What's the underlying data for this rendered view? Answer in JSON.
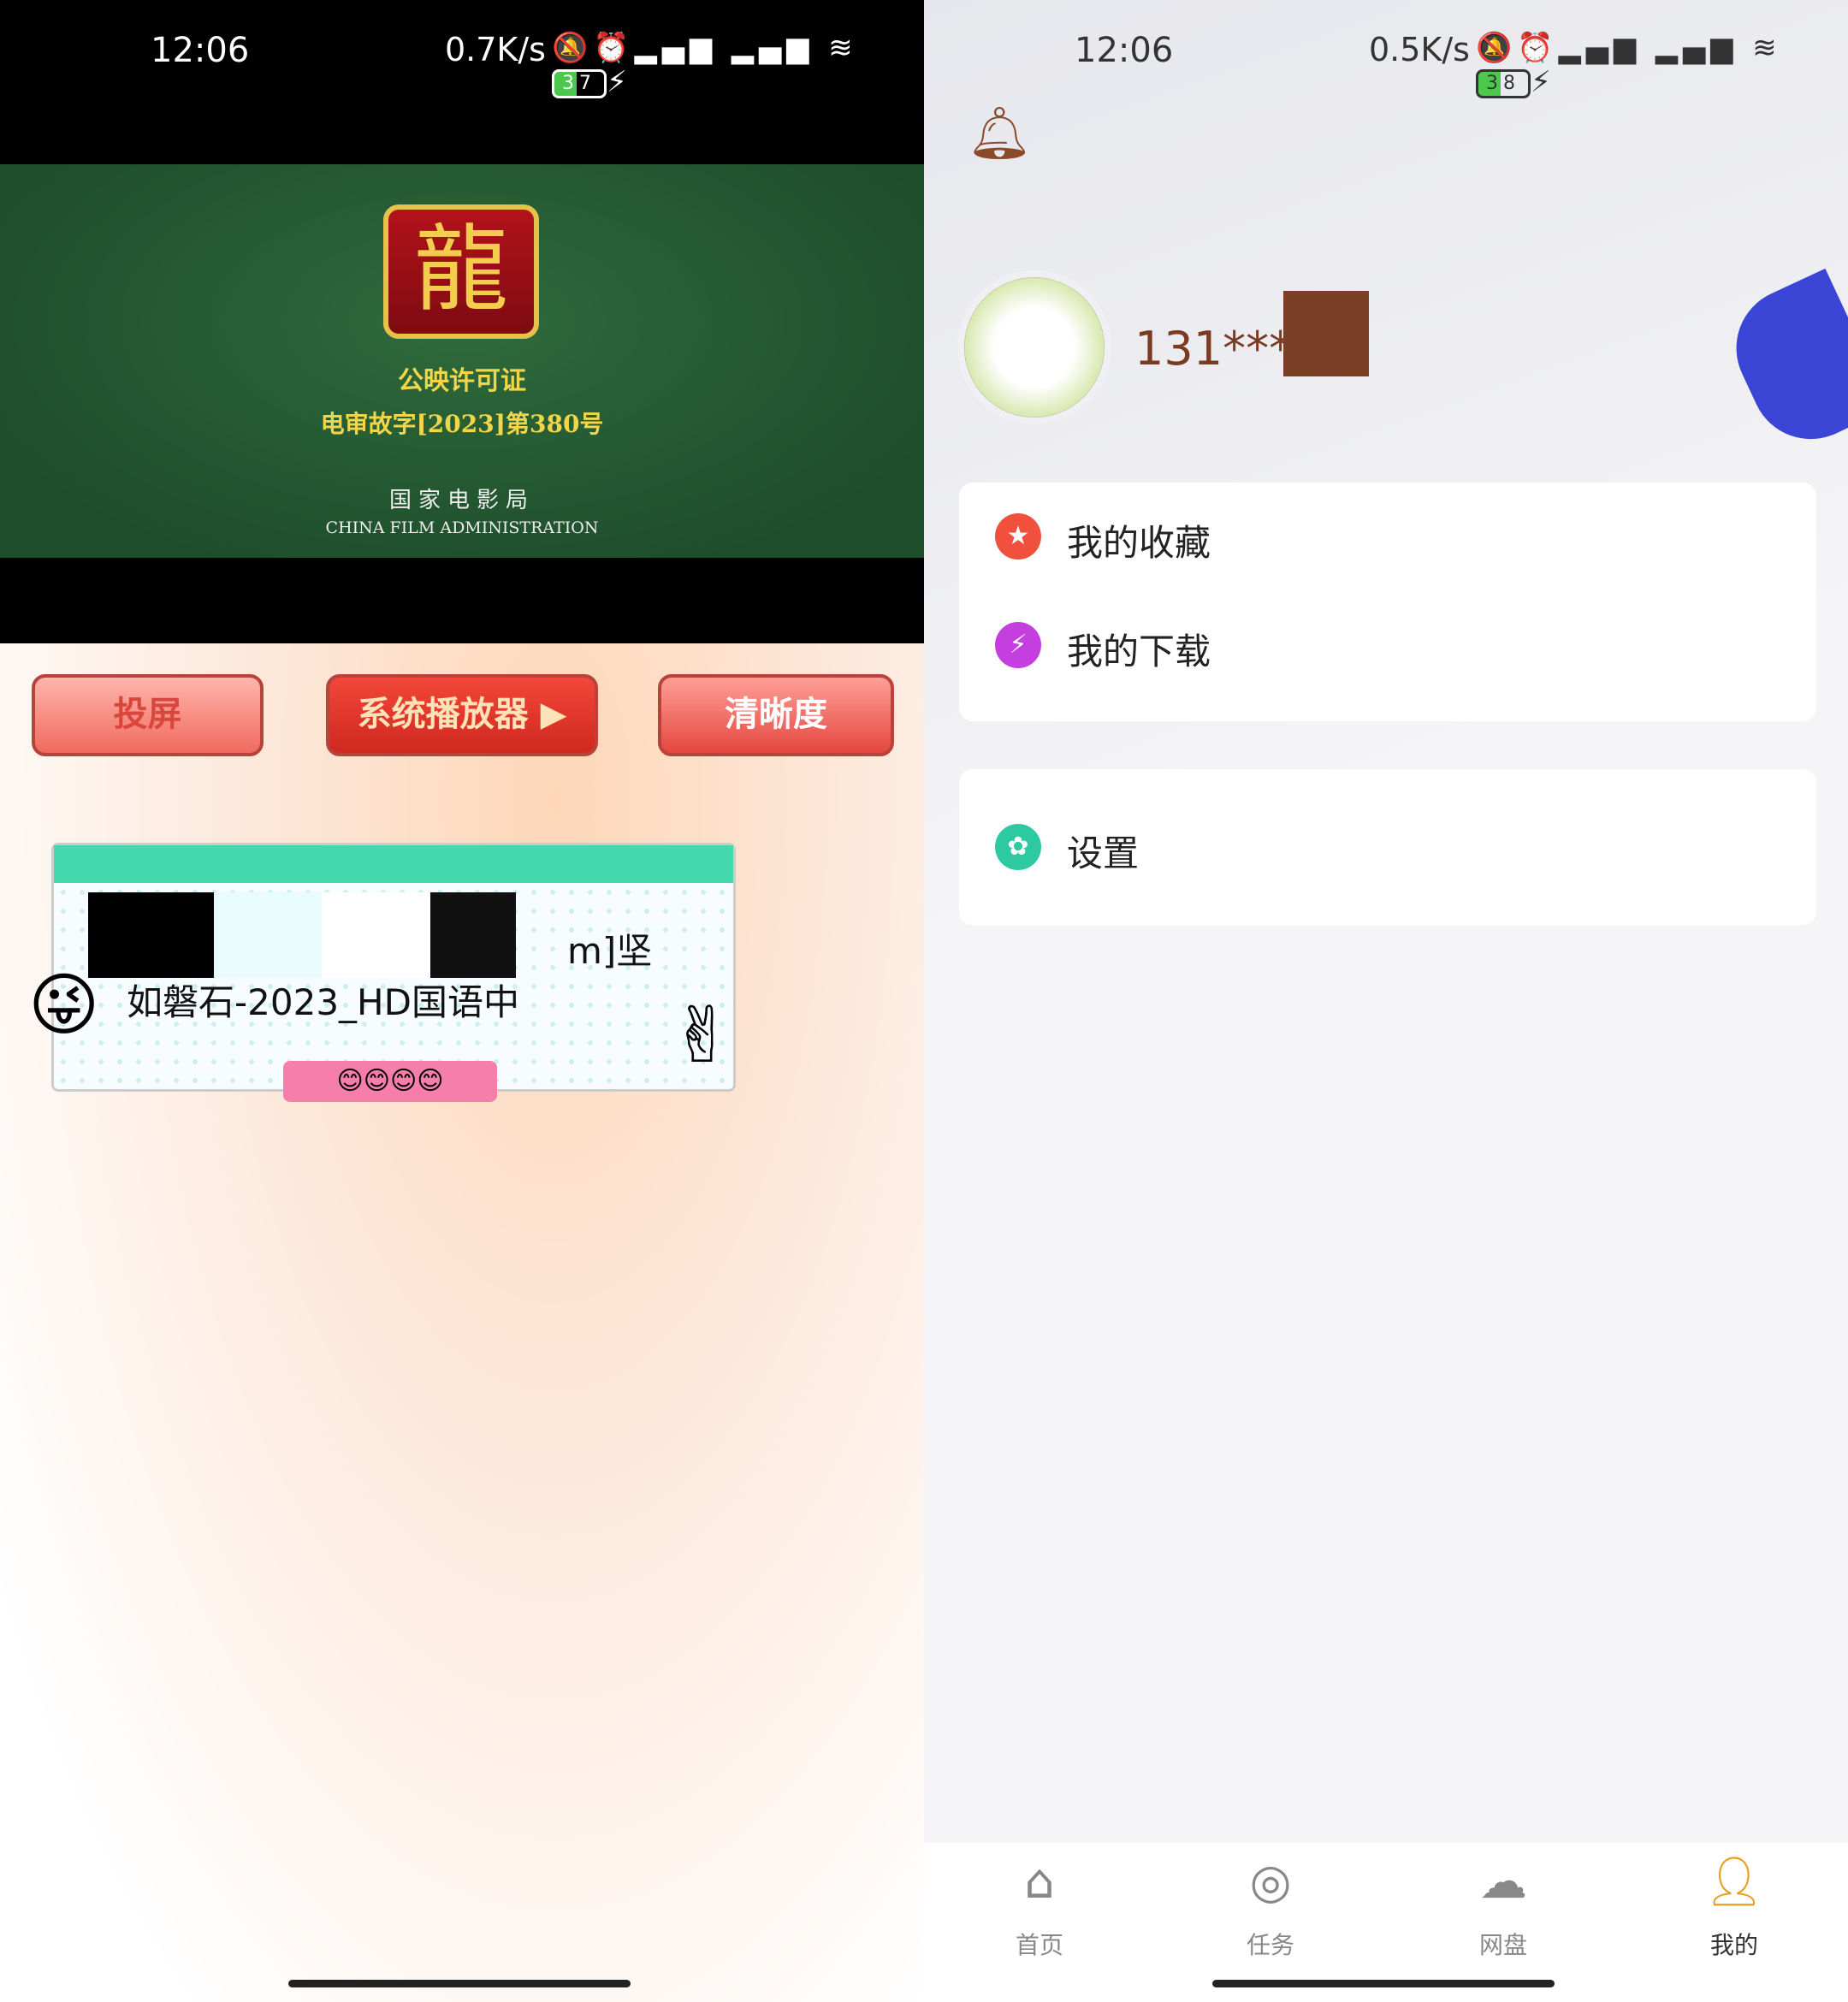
{
  "left": {
    "status": {
      "time": "12:06",
      "net_speed": "0.7K/s",
      "battery": "37"
    },
    "license": {
      "title": "公映许可证",
      "number": "电审故字[2023]第380号",
      "org_cn": "国家电影局",
      "org_en": "CHINA FILM ADMINISTRATION"
    },
    "buttons": {
      "cast": "投屏",
      "system_player": "系统播放器",
      "quality": "清晰度"
    },
    "file": {
      "line1": "m]坚",
      "line2": "如磐石-2023_HD国语中"
    }
  },
  "right": {
    "status": {
      "time": "12:06",
      "net_speed": "0.5K/s",
      "battery": "38"
    },
    "user": {
      "phone": "131****1"
    },
    "menu": [
      {
        "label": "我的收藏",
        "icon": "star-icon",
        "color": "#f0503c"
      },
      {
        "label": "我的下载",
        "icon": "lightning-icon",
        "color": "#c43ee0"
      }
    ],
    "settings": {
      "label": "设置",
      "icon": "gear-icon",
      "color": "#2dc9a0"
    },
    "tabs": [
      {
        "label": "首页",
        "icon": "home-icon"
      },
      {
        "label": "任务",
        "icon": "compass-icon"
      },
      {
        "label": "网盘",
        "icon": "cloud-icon"
      },
      {
        "label": "我的",
        "icon": "user-icon",
        "active": true
      }
    ]
  }
}
